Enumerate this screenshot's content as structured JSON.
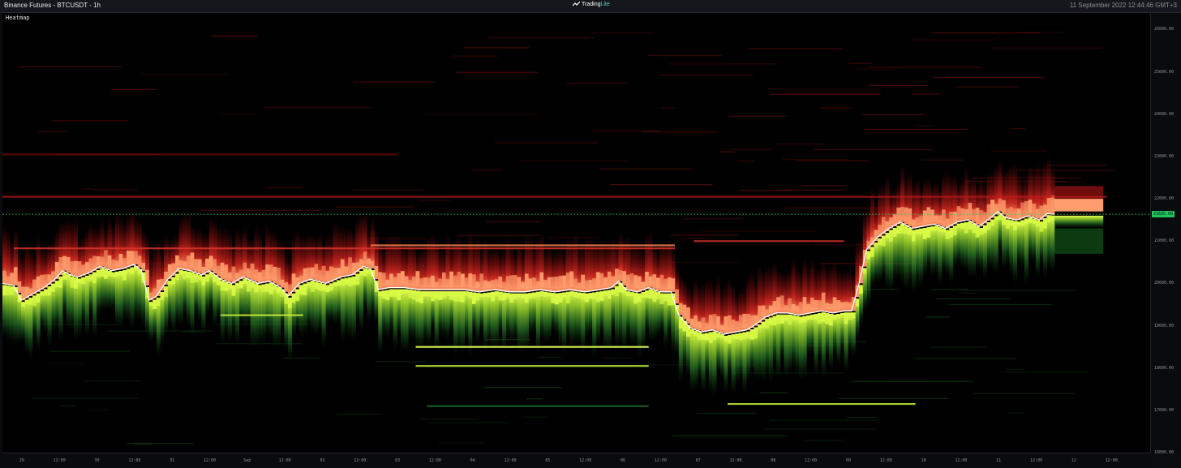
{
  "window": {
    "title": "Binance Futures - BTCUSDT - 1h",
    "brand_prefix": "Trading",
    "brand_suffix": "Lite",
    "datetime": "11 September 2022 12:44:46 GMT+3"
  },
  "chart_data": {
    "type": "heatmap",
    "title": "Heatmap",
    "ylim": [
      16000,
      26200
    ],
    "y_ticks": [
      {
        "value": 26000,
        "label": "26000.00"
      },
      {
        "value": 25000,
        "label": "25000.00"
      },
      {
        "value": 24000,
        "label": "24000.00"
      },
      {
        "value": 23000,
        "label": "23000.00"
      },
      {
        "value": 22000,
        "label": "22000.00"
      },
      {
        "value": 21000,
        "label": "21000.00"
      },
      {
        "value": 20000,
        "label": "20000.00"
      },
      {
        "value": 19000,
        "label": "19000.00"
      },
      {
        "value": 18000,
        "label": "18000.00"
      },
      {
        "value": 17000,
        "label": "17000.00"
      },
      {
        "value": 16000,
        "label": "16000.00"
      }
    ],
    "x_ticks": [
      {
        "label": "29",
        "t": 0.3
      },
      {
        "label": "12:00",
        "t": 1.3
      },
      {
        "label": "30",
        "t": 2.3
      },
      {
        "label": "12:00",
        "t": 3.3
      },
      {
        "label": "31",
        "t": 4.3
      },
      {
        "label": "12:00",
        "t": 5.3
      },
      {
        "label": "Sep",
        "t": 6.3
      },
      {
        "label": "12:00",
        "t": 7.3
      },
      {
        "label": "02",
        "t": 8.3
      },
      {
        "label": "12:00",
        "t": 9.3
      },
      {
        "label": "03",
        "t": 10.3
      },
      {
        "label": "12:00",
        "t": 11.3
      },
      {
        "label": "04",
        "t": 12.3
      },
      {
        "label": "12:00",
        "t": 13.3
      },
      {
        "label": "05",
        "t": 14.3
      },
      {
        "label": "12:00",
        "t": 15.3
      },
      {
        "label": "06",
        "t": 16.3
      },
      {
        "label": "12:00",
        "t": 17.3
      },
      {
        "label": "07",
        "t": 18.3
      },
      {
        "label": "12:00",
        "t": 19.3
      },
      {
        "label": "08",
        "t": 20.3
      },
      {
        "label": "12:00",
        "t": 21.3
      },
      {
        "label": "09",
        "t": 22.3
      },
      {
        "label": "12:00",
        "t": 23.3
      },
      {
        "label": "10",
        "t": 24.3
      },
      {
        "label": "12:00",
        "t": 25.3
      },
      {
        "label": "11",
        "t": 26.3
      },
      {
        "label": "12:00",
        "t": 27.3
      },
      {
        "label": "12",
        "t": 28.3
      },
      {
        "label": "12:00",
        "t": 29.3
      }
    ],
    "t_range": [
      0,
      29.9
    ],
    "current_price": {
      "value": 21635,
      "label": "21635.00",
      "color": "#22c55e"
    },
    "price_line": [
      [
        0.0,
        20000
      ],
      [
        0.3,
        19950
      ],
      [
        0.5,
        19600
      ],
      [
        0.8,
        19750
      ],
      [
        1.1,
        19900
      ],
      [
        1.4,
        20100
      ],
      [
        1.6,
        20300
      ],
      [
        1.8,
        20200
      ],
      [
        2.0,
        20150
      ],
      [
        2.3,
        20250
      ],
      [
        2.6,
        20400
      ],
      [
        2.9,
        20300
      ],
      [
        3.2,
        20350
      ],
      [
        3.5,
        20450
      ],
      [
        3.7,
        20300
      ],
      [
        3.9,
        19600
      ],
      [
        4.1,
        19700
      ],
      [
        4.4,
        20100
      ],
      [
        4.7,
        20350
      ],
      [
        5.0,
        20300
      ],
      [
        5.3,
        20200
      ],
      [
        5.5,
        20300
      ],
      [
        5.8,
        20100
      ],
      [
        6.1,
        20000
      ],
      [
        6.4,
        20150
      ],
      [
        6.8,
        20000
      ],
      [
        7.1,
        20050
      ],
      [
        7.4,
        19900
      ],
      [
        7.6,
        19700
      ],
      [
        7.9,
        20000
      ],
      [
        8.2,
        20100
      ],
      [
        8.6,
        20000
      ],
      [
        9.0,
        20150
      ],
      [
        9.3,
        20200
      ],
      [
        9.6,
        20400
      ],
      [
        9.8,
        20350
      ],
      [
        10.0,
        19850
      ],
      [
        10.3,
        19900
      ],
      [
        10.7,
        19900
      ],
      [
        11.1,
        19850
      ],
      [
        11.5,
        19850
      ],
      [
        11.9,
        19850
      ],
      [
        12.3,
        19850
      ],
      [
        12.7,
        19800
      ],
      [
        13.1,
        19850
      ],
      [
        13.5,
        19800
      ],
      [
        13.9,
        19800
      ],
      [
        14.3,
        19850
      ],
      [
        14.7,
        19800
      ],
      [
        15.1,
        19850
      ],
      [
        15.5,
        19800
      ],
      [
        15.9,
        19850
      ],
      [
        16.2,
        19900
      ],
      [
        16.4,
        20050
      ],
      [
        16.6,
        19850
      ],
      [
        16.9,
        19800
      ],
      [
        17.2,
        19900
      ],
      [
        17.5,
        19800
      ],
      [
        17.8,
        19800
      ],
      [
        18.0,
        19250
      ],
      [
        18.3,
        18950
      ],
      [
        18.6,
        18850
      ],
      [
        18.9,
        18900
      ],
      [
        19.2,
        18800
      ],
      [
        19.5,
        18850
      ],
      [
        19.8,
        18900
      ],
      [
        20.0,
        19000
      ],
      [
        20.3,
        19200
      ],
      [
        20.6,
        19300
      ],
      [
        20.9,
        19300
      ],
      [
        21.2,
        19250
      ],
      [
        21.5,
        19300
      ],
      [
        21.8,
        19350
      ],
      [
        22.1,
        19300
      ],
      [
        22.4,
        19350
      ],
      [
        22.6,
        19350
      ],
      [
        22.8,
        20000
      ],
      [
        23.0,
        20800
      ],
      [
        23.3,
        21100
      ],
      [
        23.6,
        21300
      ],
      [
        23.9,
        21450
      ],
      [
        24.2,
        21300
      ],
      [
        24.5,
        21350
      ],
      [
        24.8,
        21400
      ],
      [
        25.1,
        21300
      ],
      [
        25.4,
        21450
      ],
      [
        25.7,
        21500
      ],
      [
        26.0,
        21350
      ],
      [
        26.3,
        21550
      ],
      [
        26.5,
        21700
      ],
      [
        26.7,
        21550
      ],
      [
        27.0,
        21500
      ],
      [
        27.3,
        21600
      ],
      [
        27.6,
        21500
      ],
      [
        27.8,
        21650
      ],
      [
        28.0,
        21635
      ]
    ],
    "static_levels": [
      {
        "t0": 0.0,
        "t1": 29.4,
        "price": 22050,
        "color": "#c21a1a",
        "opacity": 0.7
      },
      {
        "t0": 0.0,
        "t1": 10.5,
        "price": 23050,
        "color": "#8a0f0f",
        "opacity": 0.6
      },
      {
        "t0": 0.3,
        "t1": 17.9,
        "price": 20830,
        "color": "#d8352a",
        "opacity": 0.85
      },
      {
        "t0": 9.8,
        "t1": 17.9,
        "price": 20900,
        "color": "#f07a4a",
        "opacity": 0.9
      },
      {
        "t0": 11.0,
        "t1": 17.2,
        "price": 18500,
        "color": "#d5f54a",
        "opacity": 0.95
      },
      {
        "t0": 11.0,
        "t1": 17.2,
        "price": 18050,
        "color": "#b8e23a",
        "opacity": 0.9
      },
      {
        "t0": 19.3,
        "t1": 24.3,
        "price": 17150,
        "color": "#b8e23a",
        "opacity": 0.9
      },
      {
        "t0": 11.3,
        "t1": 17.2,
        "price": 17100,
        "color": "#1f6b2a",
        "opacity": 0.8
      },
      {
        "t0": 5.8,
        "t1": 8.0,
        "price": 19250,
        "color": "#c8ef3a",
        "opacity": 0.85
      },
      {
        "t0": 18.4,
        "t1": 22.4,
        "price": 21000,
        "color": "#d8352a",
        "opacity": 0.8
      }
    ]
  }
}
